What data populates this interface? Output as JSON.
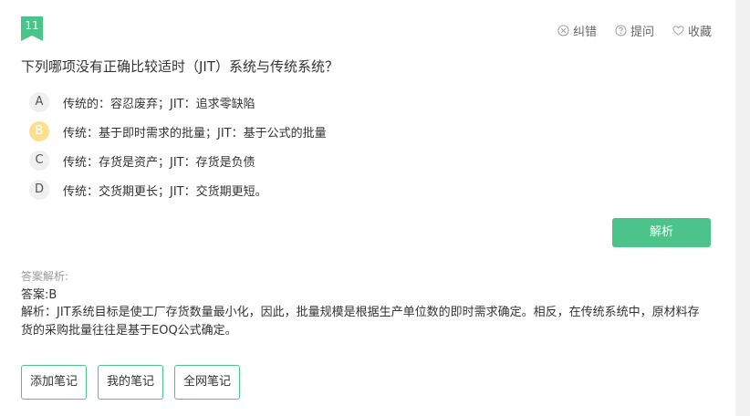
{
  "question": {
    "number": "11",
    "text": "下列哪项没有正确比较适时（JIT）系统与传统系统？",
    "options": [
      {
        "letter": "A",
        "text": "传统的：容忍废弃；JIT：追求零缺陷",
        "selected": false
      },
      {
        "letter": "B",
        "text": "传统：基于即时需求的批量；JIT：基于公式的批量",
        "selected": true
      },
      {
        "letter": "C",
        "text": "传统：存货是资产；JIT：存货是负债",
        "selected": false
      },
      {
        "letter": "D",
        "text": "传统：交货期更长；JIT：交货期更短。",
        "selected": false
      }
    ]
  },
  "actions": {
    "correct_label": "纠错",
    "ask_label": "提问",
    "favorite_label": "收藏"
  },
  "analyze_button_label": "解析",
  "analysis": {
    "title": "答案解析:",
    "answer": "答案:B",
    "explanation": "解析：JIT系统目标是使工厂存货数量最小化，因此，批量规模是根据生产单位数的即时需求确定。相反，在传统系统中，原材料存货的采购批量往往是基于EOQ公式确定。"
  },
  "note_buttons": {
    "add": "添加笔记",
    "mine": "我的笔记",
    "all": "全网笔记"
  },
  "colors": {
    "accent": "#4cc38a",
    "selected_option": "#fde08d"
  }
}
